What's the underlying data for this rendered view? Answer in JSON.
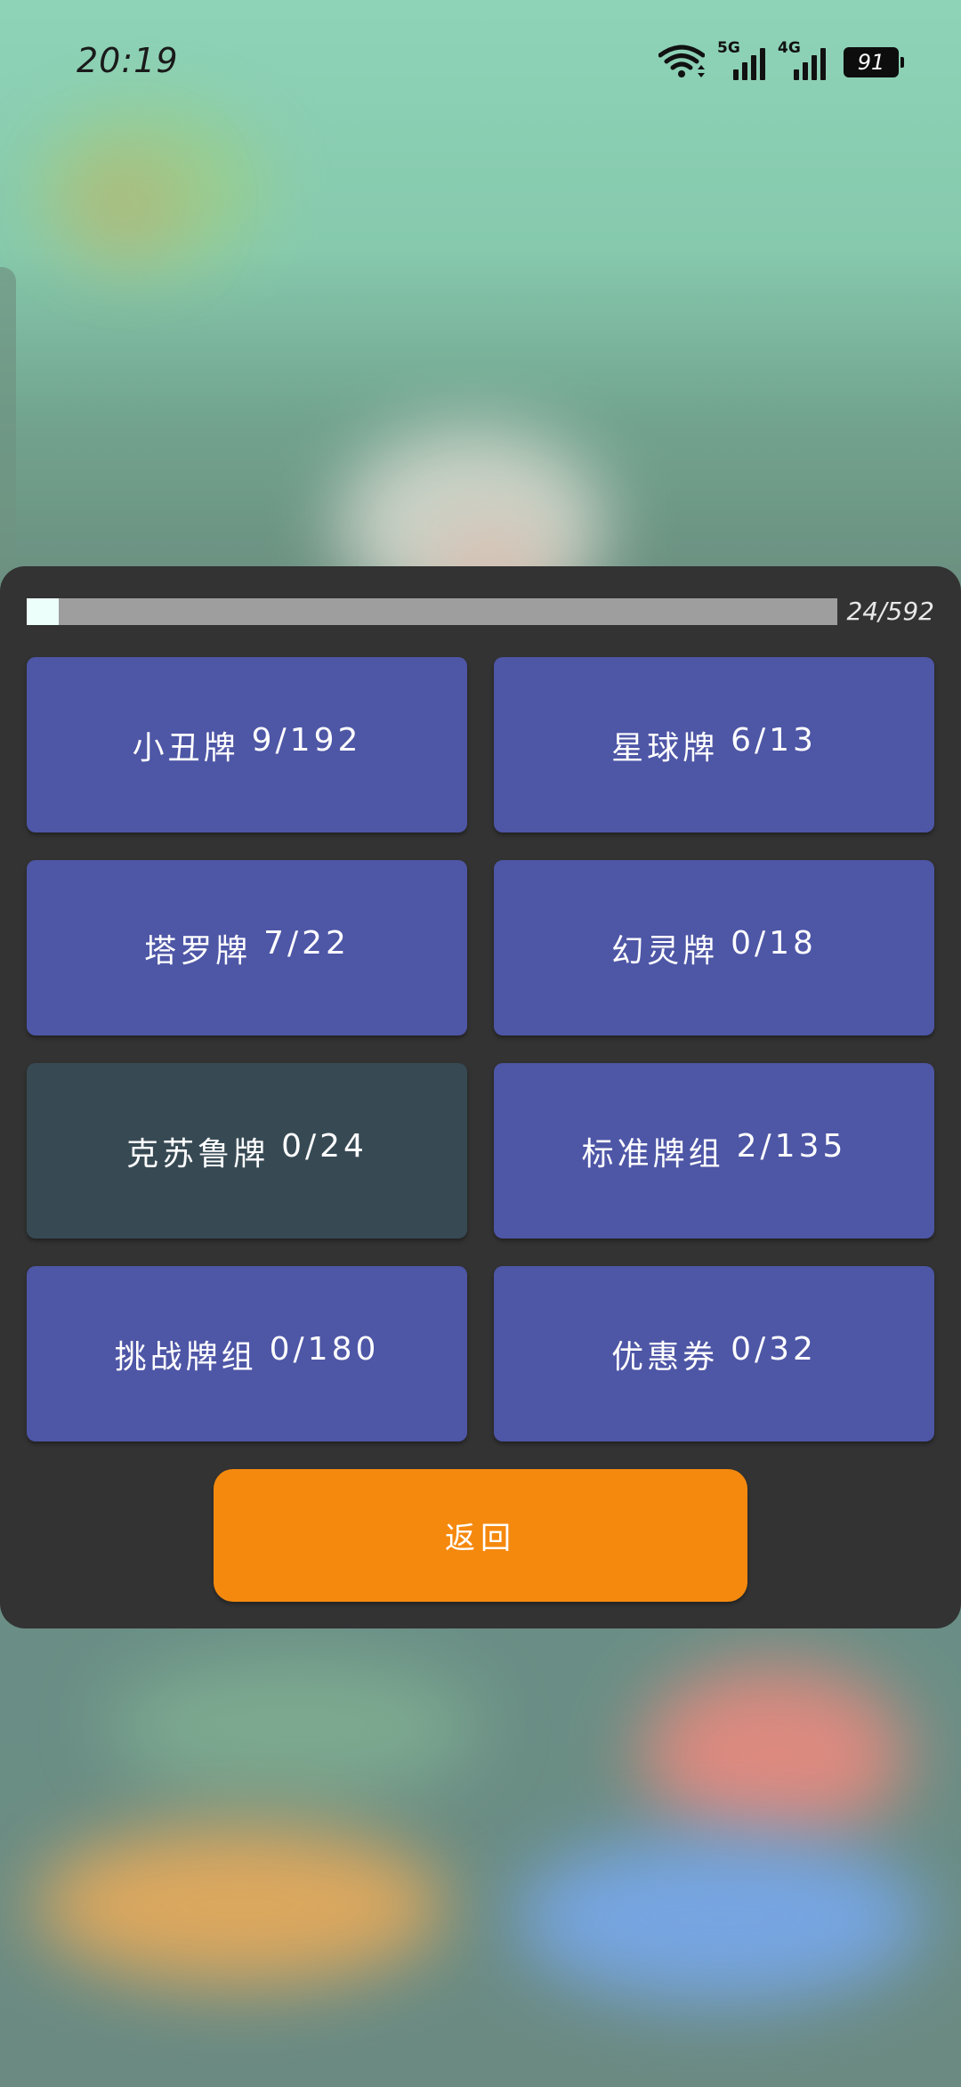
{
  "status_bar": {
    "time": "20:19",
    "network_1": "5G",
    "network_2": "4G",
    "battery": "91"
  },
  "progress": {
    "fraction": 0.04,
    "text": "24/592"
  },
  "decks": [
    {
      "name": "小丑牌",
      "count": "9/192",
      "style": "normal"
    },
    {
      "name": "星球牌",
      "count": "6/13",
      "style": "normal"
    },
    {
      "name": "塔罗牌",
      "count": "7/22",
      "style": "normal"
    },
    {
      "name": "幻灵牌",
      "count": "0/18",
      "style": "normal"
    },
    {
      "name": "克苏鲁牌",
      "count": "0/24",
      "style": "selected-dark"
    },
    {
      "name": "标准牌组",
      "count": "2/135",
      "style": "normal"
    },
    {
      "name": "挑战牌组",
      "count": "0/180",
      "style": "normal"
    },
    {
      "name": "优惠券",
      "count": "0/32",
      "style": "normal"
    }
  ],
  "return_label": "返回",
  "colors": {
    "panel": "#333333",
    "card": "#4e56a6",
    "card_dark": "#374a54",
    "return": "#f5890e"
  }
}
